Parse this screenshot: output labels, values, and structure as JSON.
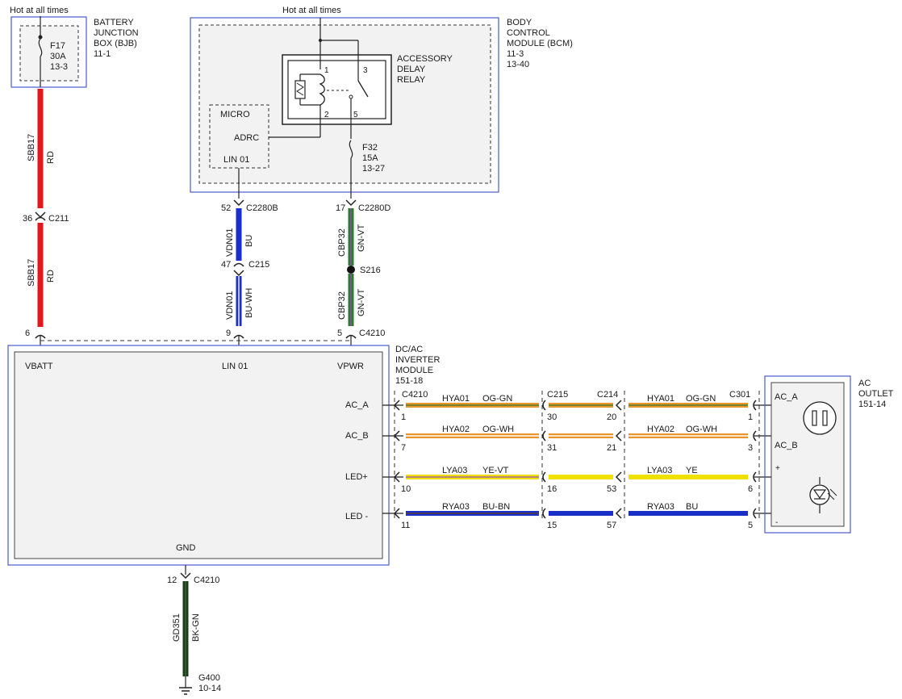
{
  "bjb": {
    "hot_label": "Hot at all times",
    "title": [
      "BATTERY",
      "JUNCTION",
      "BOX (BJB)",
      "11-1"
    ],
    "fuse": [
      "F17",
      "30A",
      "13-3"
    ]
  },
  "bcm": {
    "hot_label": "Hot at all times",
    "title": [
      "BODY",
      "CONTROL",
      "MODULE (BCM)",
      "11-3",
      "13-40"
    ],
    "relay_title": [
      "ACCESSORY",
      "DELAY",
      "RELAY"
    ],
    "relay_pins": [
      "1",
      "2",
      "3",
      "5"
    ],
    "micro": "MICRO",
    "adrc": "ADRC",
    "lin": "LIN 01",
    "fuse": [
      "F32",
      "15A",
      "13-27"
    ]
  },
  "wires": {
    "sbb17_upper": {
      "circuit": "SBB17",
      "color": "RD"
    },
    "sbb17_lower": {
      "circuit": "SBB17",
      "color": "RD"
    },
    "vdn01_upper": {
      "circuit": "VDN01",
      "color": "BU"
    },
    "vdn01_lower": {
      "circuit": "VDN01",
      "color": "BU-WH"
    },
    "cbp32_upper": {
      "circuit": "CBP32",
      "color": "GN-VT"
    },
    "cbp32_lower": {
      "circuit": "CBP32",
      "color": "GN-VT"
    },
    "gd351": {
      "circuit": "GD351",
      "color": "BK-GN"
    }
  },
  "connectors": {
    "c211": {
      "pin": "36",
      "name": "C211"
    },
    "bjb_out_pin": "6",
    "c2280b": {
      "pin": "52",
      "name": "C2280B"
    },
    "c215_lin": {
      "pin": "47",
      "name": "C215"
    },
    "c4210_lin_pin": "9",
    "c2280d": {
      "pin": "17",
      "name": "C2280D"
    },
    "s216": "S216",
    "c4210_vpwr": {
      "pin": "5",
      "name": "C4210"
    },
    "c4210_gnd": {
      "pin": "12",
      "name": "C4210"
    }
  },
  "inverter": {
    "title": [
      "DC/AC",
      "INVERTER",
      "MODULE",
      "151-18"
    ],
    "pins": {
      "vbatt": "VBATT",
      "lin": "LIN 01",
      "vpwr": "VPWR",
      "ac_a": "AC_A",
      "ac_b": "AC_B",
      "led_pos": "LED+",
      "led_neg": "LED -",
      "gnd": "GND"
    }
  },
  "harness": {
    "c4210": "C4210",
    "c215": "C215",
    "c214": "C214",
    "c301": "C301",
    "rows": [
      {
        "circuit_a": "HYA01",
        "color_a": "OG-GN",
        "pin_c4210": "1",
        "pin_c215": "30",
        "pin_c214": "20",
        "circuit_b": "HYA01",
        "color_b": "OG-GN",
        "pin_c301": "1"
      },
      {
        "circuit_a": "HYA02",
        "color_a": "OG-WH",
        "pin_c4210": "7",
        "pin_c215": "31",
        "pin_c214": "21",
        "circuit_b": "HYA02",
        "color_b": "OG-WH",
        "pin_c301": "3"
      },
      {
        "circuit_a": "LYA03",
        "color_a": "YE-VT",
        "pin_c4210": "10",
        "pin_c215": "16",
        "pin_c214": "53",
        "circuit_b": "LYA03",
        "color_b": "YE",
        "pin_c301": "6"
      },
      {
        "circuit_a": "RYA03",
        "color_a": "BU-BN",
        "pin_c4210": "11",
        "pin_c215": "15",
        "pin_c214": "57",
        "circuit_b": "RYA03",
        "color_b": "BU",
        "pin_c301": "5"
      }
    ]
  },
  "ac_outlet": {
    "title": [
      "AC",
      "OUTLET",
      "151-14"
    ],
    "ac_a": "AC_A",
    "ac_b": "AC_B",
    "plus": "+",
    "minus": "-"
  },
  "ground": {
    "name": "G400",
    "ref": "10-14"
  },
  "colors": {
    "red": "#e8141c",
    "blue": "#1b2fd0",
    "green": "#2f7a2f",
    "black": "#1f3a1f",
    "orange": "#e8962a",
    "yellow": "#f0e000",
    "navy": "#1a2fc8",
    "box_border": "#4b5bd0"
  }
}
